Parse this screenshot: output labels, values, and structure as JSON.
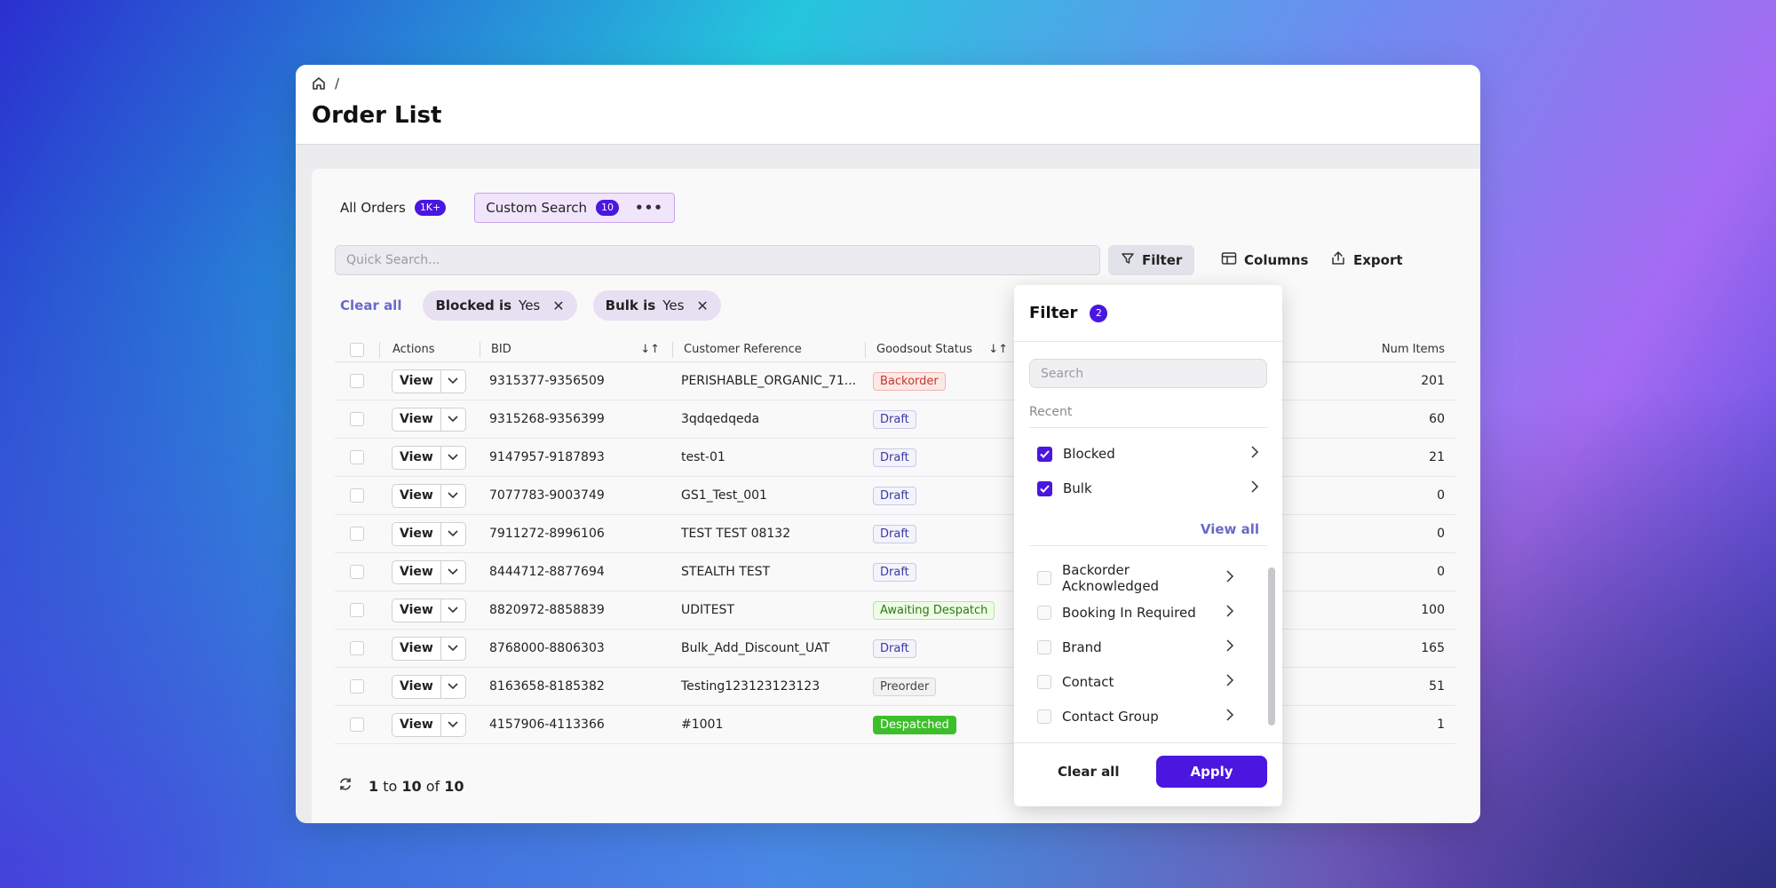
{
  "breadcrumb": {
    "separator": "/"
  },
  "page": {
    "title": "Order List"
  },
  "tabs": [
    {
      "label": "All Orders",
      "badge": "1K+"
    },
    {
      "label": "Custom Search",
      "badge": "10"
    }
  ],
  "search": {
    "placeholder": "Quick Search..."
  },
  "toolbar": {
    "filter": "Filter",
    "columns": "Columns",
    "export": "Export"
  },
  "chips": {
    "clear_all": "Clear all",
    "items": [
      {
        "field": "Blocked is",
        "value": "Yes"
      },
      {
        "field": "Bulk is",
        "value": "Yes"
      }
    ]
  },
  "table": {
    "headers": {
      "actions": "Actions",
      "bid": "BID",
      "ref": "Customer Reference",
      "status": "Goodsout Status",
      "items": "Num Items"
    },
    "view_label": "View",
    "rows": [
      {
        "bid": "9315377-9356509",
        "ref": "PERISHABLE_ORGANIC_71...",
        "status": "Backorder",
        "status_class": "st-Backorder",
        "items": "201"
      },
      {
        "bid": "9315268-9356399",
        "ref": "3qdqedqeda",
        "status": "Draft",
        "status_class": "st-Draft",
        "items": "60"
      },
      {
        "bid": "9147957-9187893",
        "ref": "test-01",
        "status": "Draft",
        "status_class": "st-Draft",
        "items": "21"
      },
      {
        "bid": "7077783-9003749",
        "ref": "GS1_Test_001",
        "status": "Draft",
        "status_class": "st-Draft",
        "items": "0"
      },
      {
        "bid": "7911272-8996106",
        "ref": "TEST TEST 08132",
        "status": "Draft",
        "status_class": "st-Draft",
        "items": "0"
      },
      {
        "bid": "8444712-8877694",
        "ref": "STEALTH TEST",
        "status": "Draft",
        "status_class": "st-Draft",
        "items": "0"
      },
      {
        "bid": "8820972-8858839",
        "ref": "UDITEST",
        "status": "Awaiting Despatch",
        "status_class": "st-Awaiting",
        "items": "100"
      },
      {
        "bid": "8768000-8806303",
        "ref": "Bulk_Add_Discount_UAT",
        "status": "Draft",
        "status_class": "st-Draft",
        "items": "165"
      },
      {
        "bid": "8163658-8185382",
        "ref": "Testing123123123123",
        "status": "Preorder",
        "status_class": "st-Preorder",
        "items": "51"
      },
      {
        "bid": "4157906-4113366",
        "ref": "#1001",
        "status": "Despatched",
        "status_class": "st-Despatched",
        "items": "1"
      }
    ]
  },
  "pager": {
    "from": "1",
    "to_word": "to",
    "to": "10",
    "of_word": "of",
    "total": "10"
  },
  "filter_popover": {
    "title": "Filter",
    "count": "2",
    "search_placeholder": "Search",
    "recent_label": "Recent",
    "recent": [
      {
        "label": "Blocked",
        "checked": true
      },
      {
        "label": "Bulk",
        "checked": true
      }
    ],
    "view_all": "View all",
    "list": [
      {
        "label": "Backorder Acknowledged"
      },
      {
        "label": "Booking In Required"
      },
      {
        "label": "Brand"
      },
      {
        "label": "Contact"
      },
      {
        "label": "Contact Group"
      }
    ],
    "clear_all": "Clear all",
    "apply": "Apply"
  },
  "colors": {
    "accent": "#4a16e0",
    "link": "#6a6ac8"
  }
}
